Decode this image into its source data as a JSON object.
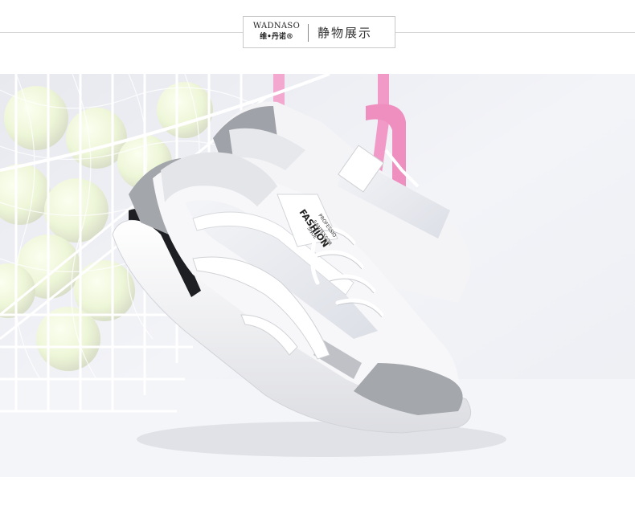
{
  "header": {
    "brand_name": "WADNASO",
    "brand_name_cn": "维•丹诺®",
    "section_title": "静物展示"
  },
  "photo": {
    "tongue_label": "FASHION",
    "side_text_lines": [
      "PROFESSIO",
      "SANTESSOR",
      "SHOE"
    ]
  }
}
